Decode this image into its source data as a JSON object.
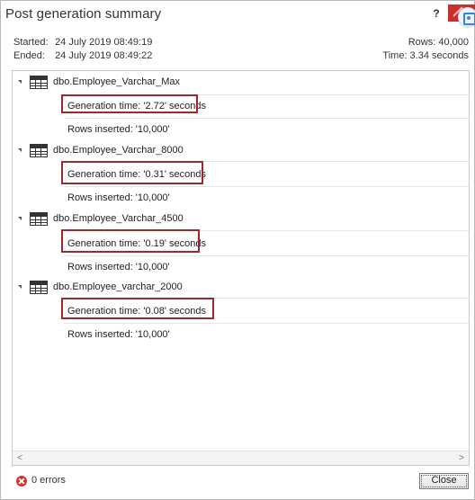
{
  "window": {
    "title": "Post generation summary",
    "help_label": "?"
  },
  "summary": {
    "started_label": "Started:",
    "started_value": "24 July 2019 08:49:19",
    "ended_label": "Ended:",
    "ended_value": "24 July 2019 08:49:22",
    "rows": "Rows:  40,000",
    "time": "Time:  3.34 seconds"
  },
  "tables": [
    {
      "name": "dbo.Employee_Varchar_Max",
      "generation": "Generation time: '2.72' seconds",
      "rows": "Rows inserted: '10,000'"
    },
    {
      "name": "dbo.Employee_Varchar_8000",
      "generation": "Generation time: '0.31' seconds",
      "rows": "Rows inserted: '10,000'"
    },
    {
      "name": "dbo.Employee_Varchar_4500",
      "generation": "Generation time: '0.19' seconds",
      "rows": "Rows inserted: '10,000'"
    },
    {
      "name": "dbo.Employee_varchar_2000",
      "generation": "Generation time: '0.08' seconds",
      "rows": "Rows inserted: '10,000'"
    }
  ],
  "scrollbar": {
    "left_arrow": "<",
    "right_arrow": ">"
  },
  "footer": {
    "errors": "0 errors",
    "close_label": "Close"
  },
  "colors": {
    "highlight_border": "#a0282d",
    "error_icon": "#d6312b",
    "title_close_bg": "#c9302c"
  },
  "icons": {
    "table": "table-icon",
    "expander": "expand-arrow-icon",
    "error": "error-icon"
  }
}
